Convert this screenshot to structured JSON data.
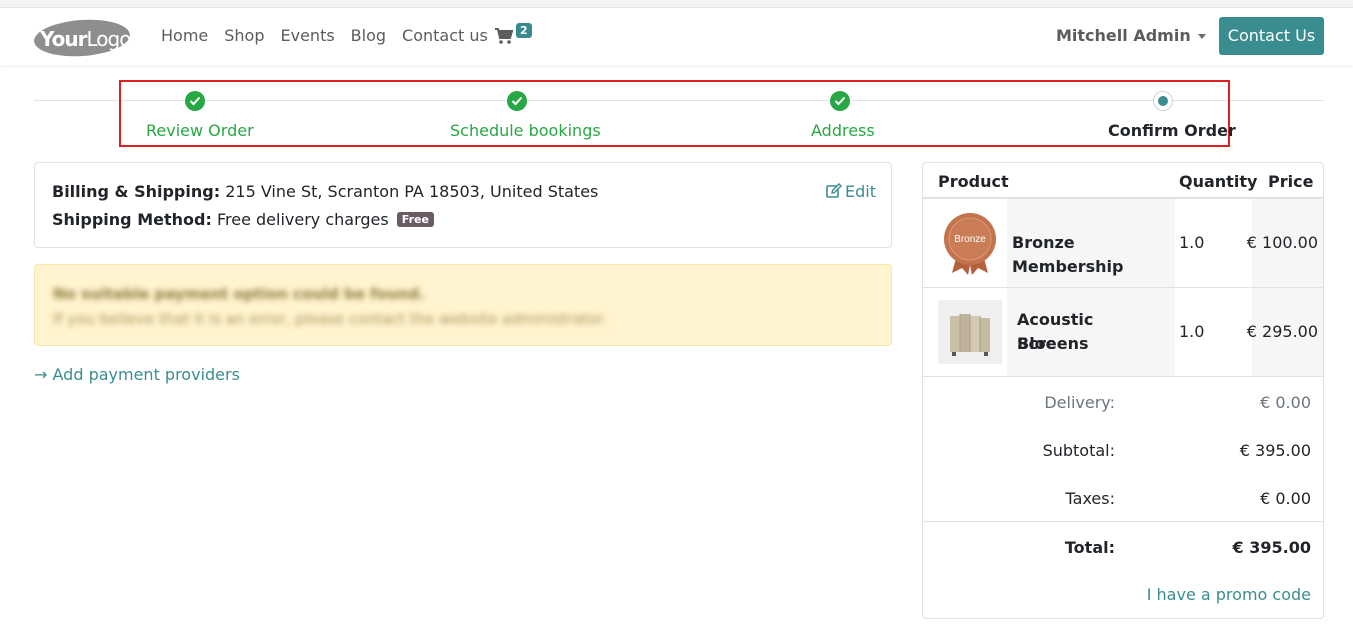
{
  "header": {
    "logo": {
      "part1": "Your",
      "part2": "Logo"
    },
    "nav": [
      "Home",
      "Shop",
      "Events",
      "Blog",
      "Contact us"
    ],
    "cart_count": "2",
    "user_name": "Mitchell Admin",
    "contact_button": "Contact Us"
  },
  "steps": [
    {
      "label": "Review Order",
      "state": "done"
    },
    {
      "label": "Schedule bookings",
      "state": "done"
    },
    {
      "label": "Address",
      "state": "done"
    },
    {
      "label": "Confirm Order",
      "state": "current"
    }
  ],
  "billing": {
    "billing_label": "Billing & Shipping:",
    "billing_value": "215 Vine St, Scranton PA 18503, United States",
    "shipping_label": "Shipping Method:",
    "shipping_value": "Free delivery charges",
    "shipping_badge": "Free",
    "edit_label": "Edit"
  },
  "payment_alert": {
    "title": "No suitable payment option could be found.",
    "message": "If you believe that it is an error, please contact the website administrator."
  },
  "add_payment_providers": "Add payment providers",
  "summary": {
    "headers": {
      "product": "Product",
      "quantity": "Quantity",
      "price": "Price"
    },
    "items": [
      {
        "name_line1": "Bronze Membership",
        "name_line2": "",
        "quantity": "1.0",
        "price": "€ 100.00",
        "image_text": "Bronze"
      },
      {
        "name_line1": "Acoustic Bloc",
        "name_line2": "Screens",
        "quantity": "1.0",
        "price": "€ 295.00",
        "image_text": ""
      }
    ],
    "delivery_label": "Delivery:",
    "delivery_value": "€ 0.00",
    "subtotal_label": "Subtotal:",
    "subtotal_value": "€ 395.00",
    "taxes_label": "Taxes:",
    "taxes_value": "€ 0.00",
    "total_label": "Total:",
    "total_value": "€ 395.00",
    "promo_link": "I have a promo code"
  },
  "colors": {
    "accent": "#3a8d8f",
    "success": "#28a745",
    "highlight_border": "#e02020",
    "alert_bg": "#fff4cf"
  }
}
